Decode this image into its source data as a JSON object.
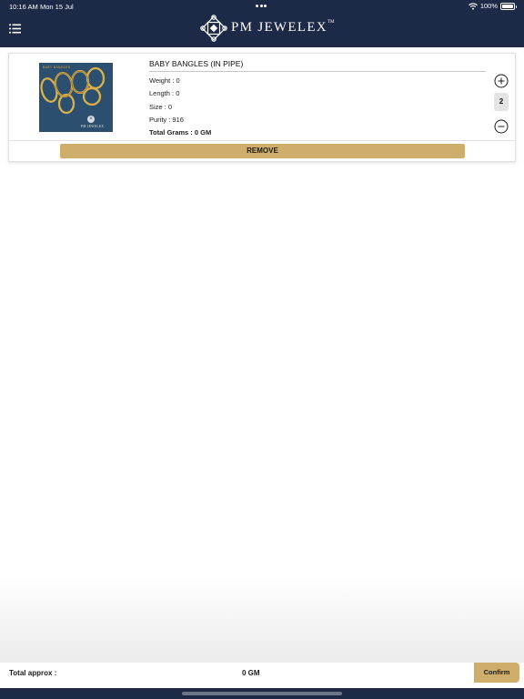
{
  "status_bar": {
    "time": "10:16 AM",
    "date": "Mon 15 Jul",
    "battery": "100%",
    "icons": [
      "wifi-icon",
      "battery-icon",
      "multitasking-dots-icon"
    ]
  },
  "header": {
    "brand_name": "PM JEWELEX",
    "brand_tm": "TM",
    "menu_icon": "menu-icon",
    "logo_icon": "diamond-logo-icon",
    "background_color": "#1c2a47"
  },
  "cart": {
    "items": [
      {
        "title": "BABY BANGLES (IN PIPE)",
        "image_caption": "BABY BANGLES",
        "image_brand": "PM JEWELEX",
        "weight": "Weight : 0",
        "length": "Length : 0",
        "size": "Size : 0",
        "purity": "Purity : 916",
        "total_grams": "Total Grams : 0 GM",
        "quantity": "2",
        "remove_label": "REMOVE"
      }
    ]
  },
  "footer": {
    "total_label": "Total approx :",
    "total_value": "0 GM",
    "confirm_label": "Confirm",
    "accent_color": "#cfae6b"
  }
}
